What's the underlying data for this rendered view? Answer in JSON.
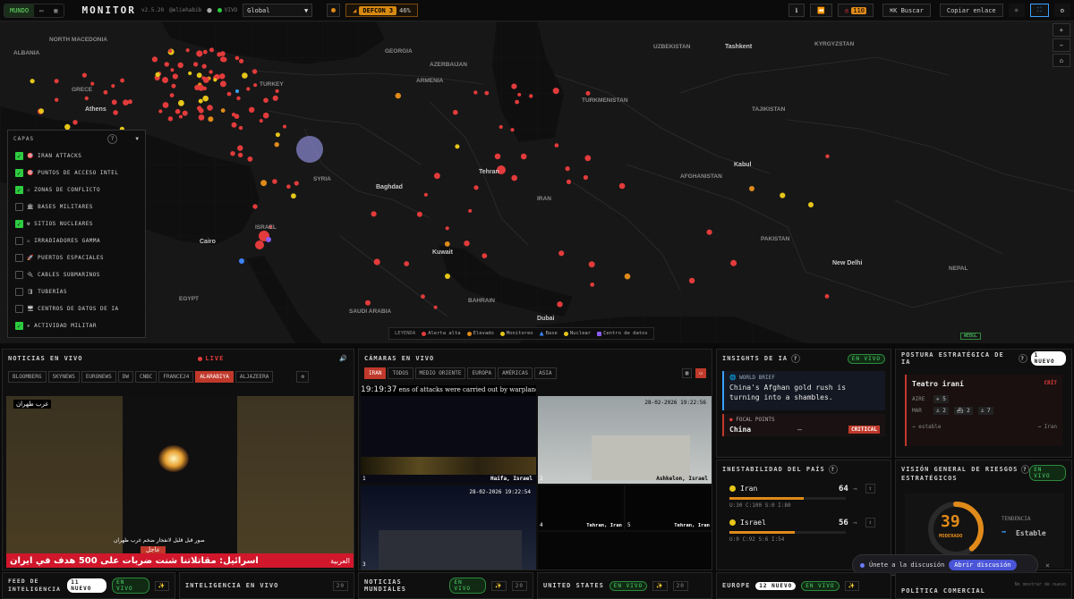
{
  "topbar": {
    "modes": [
      "MUNDO",
      "▭",
      "▦"
    ],
    "brand": "MONITOR",
    "version": "v2.5.20",
    "author": "@eliehabib",
    "live": "VIVO",
    "region": "Global",
    "defcon": "DEFCON 3",
    "defcon_pct": "46%",
    "alerts_count": "110",
    "search_label": "⌘K Buscar",
    "copy_label": "Copiar enlace"
  },
  "map": {
    "labels": [
      {
        "t": "NORTH MACEDONIA"
      },
      {
        "t": "ALBANIA"
      },
      {
        "t": "GRECE"
      },
      {
        "t": "Athens"
      },
      {
        "t": "TURKEY"
      },
      {
        "t": "AZERBAIJAN"
      },
      {
        "t": "GEORGIA"
      },
      {
        "t": "ARMENIA"
      },
      {
        "t": "UZBEKISTAN"
      },
      {
        "t": "TURKMENISTAN"
      },
      {
        "t": "Tashkent"
      },
      {
        "t": "KYRGYZSTAN"
      },
      {
        "t": "TAJIKISTAN"
      },
      {
        "t": "SYRIA"
      },
      {
        "t": "Tehran"
      },
      {
        "t": "Baghdad"
      },
      {
        "t": "IRAN"
      },
      {
        "t": "AFGHANISTAN"
      },
      {
        "t": "Kabul"
      },
      {
        "t": "PAKISTAN"
      },
      {
        "t": "ISRAEL"
      },
      {
        "t": "Cairo"
      },
      {
        "t": "EGYPT"
      },
      {
        "t": "SAUDI ARABIA"
      },
      {
        "t": "New Delhi"
      },
      {
        "t": "NEPAL"
      },
      {
        "t": "Dubai"
      },
      {
        "t": "Kuwait"
      },
      {
        "t": "BAHRAIN"
      }
    ],
    "legend_title": "LEYENDA",
    "legend": [
      {
        "label": "Alerta alta",
        "color": "#e33b3b"
      },
      {
        "label": "Elevado",
        "color": "#e08a1a"
      },
      {
        "label": "Monitoreo",
        "color": "#e6c619"
      },
      {
        "label": "Base",
        "color": "#3b82f6"
      },
      {
        "label": "Nuclear",
        "color": "#e6c619"
      },
      {
        "label": "Centro de datos",
        "color": "#8b5cf6"
      }
    ],
    "webgl": "WEBGL"
  },
  "layers": {
    "title": "CAPAS",
    "items": [
      {
        "label": "IRAN ATTACKS",
        "on": true,
        "icon": "🎯"
      },
      {
        "label": "PUNTOS DE ACCESO INTEL",
        "on": true,
        "icon": "🎯"
      },
      {
        "label": "ZONAS DE CONFLICTO",
        "on": true,
        "icon": "⚔"
      },
      {
        "label": "BASES MILITARES",
        "on": false,
        "icon": "🏛"
      },
      {
        "label": "SITIOS NUCLEARES",
        "on": true,
        "icon": "☢"
      },
      {
        "label": "IRRADIADORES GAMMA",
        "on": false,
        "icon": "⚠"
      },
      {
        "label": "PUERTOS ESPACIALES",
        "on": false,
        "icon": "🚀"
      },
      {
        "label": "CABLES SUBMARINOS",
        "on": false,
        "icon": "🔌"
      },
      {
        "label": "TUBERÍAS",
        "on": false,
        "icon": "🛢"
      },
      {
        "label": "CENTROS DE DATOS DE IA",
        "on": false,
        "icon": "🖥"
      },
      {
        "label": "ACTIVIDAD MILITAR",
        "on": true,
        "icon": "✈"
      }
    ]
  },
  "news": {
    "title": "NOTICIAS EN VIVO",
    "live": "LIVE",
    "channels": [
      "BLOOMBERG",
      "SKYNEWS",
      "EURONEWS",
      "DW",
      "CNBC",
      "FRANCE24",
      "ALARABIYA",
      "ALJAZEERA"
    ],
    "active_channel": "ALARABIYA",
    "tag": "غرب طهران",
    "caption_small": "صور قبل قليل لانفجار ضخم غرب طهران",
    "urgent": "عاجل",
    "headline": "اسرائيل: مقاتلاتنا شنت ضربات على 500 هدف في ايران",
    "logo": "العربية"
  },
  "cams": {
    "title": "CÁMARAS EN VIVO",
    "tabs": [
      "IRAN",
      "TODOS",
      "MEDIO ORIENTE",
      "EUROPA",
      "AMÉRICAS",
      "ASIA"
    ],
    "active": "IRAN",
    "clock": "19:19:37",
    "ticker": "ens of attacks were carried out by warplanes launched from bases and aircraft carrie",
    "feeds": [
      {
        "n": "1",
        "loc": "Haifa, Israel"
      },
      {
        "n": "2",
        "loc": "Ashkelon, Israel",
        "ts": "28-02-2026 19:22:56"
      },
      {
        "n": "3",
        "loc": "",
        "ts": "28-02-2026 19:22:54"
      },
      {
        "n": "4",
        "loc": "Tehran, Iran"
      },
      {
        "n": "5",
        "loc": "Tehran, Iran"
      }
    ]
  },
  "insights": {
    "title": "INSIGHTS DE IA",
    "live": "EN VIVO",
    "brief_label": "WORLD BRIEF",
    "brief_text": "China's Afghan gold rush is turning into a shambles.",
    "focal_label": "FOCAL POINTS",
    "focal_name": "China",
    "focal_dash": "—",
    "focal_level": "CRITICAL"
  },
  "instability": {
    "title": "INESTABILIDAD DEL PAÍS",
    "rows": [
      {
        "name": "Iran",
        "score": "64",
        "trend": "→",
        "metrics": "U:30  C:100  S:0  I:80",
        "fill": 0.64
      },
      {
        "name": "Israel",
        "score": "56",
        "trend": "→",
        "metrics": "U:0  C:92  S:6  I:54",
        "fill": 0.56
      }
    ]
  },
  "posture": {
    "title": "POSTURA ESTRATÉGICA DE IA",
    "badge": "1 NUEVO",
    "theater": "Teatro iraní",
    "level": "CRÍT",
    "air_label": "AIRE",
    "air": "✈ 5",
    "sea_label": "MAR",
    "sea": [
      "⚓ 2",
      "⛴ 2",
      "⚓ 7"
    ],
    "stable": "→ estable",
    "target": "→ Iran"
  },
  "risk": {
    "title": "VISIÓN GENERAL DE RIESGOS ESTRATÉGICOS",
    "live": "EN VIVO",
    "score": "39",
    "level": "MODERADO",
    "trend_label": "TENDENCIA",
    "trend_value": "Estable",
    "gauge": 0.39
  },
  "discussion": {
    "text": "Únete a la discusión",
    "button": "Abrir discusión"
  },
  "bottom": [
    {
      "title": "FEED DE INTELIGENCIA",
      "badge": "11 NUEVO",
      "live": "EN VIVO"
    },
    {
      "title": "INTELIGENCIA EN VIVO",
      "count": "20"
    },
    {
      "title": "NOTICIAS MUNDIALES",
      "live": "EN VIVO",
      "count": "20"
    },
    {
      "title": "UNITED STATES",
      "live": "EN VIVO",
      "count": "20"
    },
    {
      "title": "EUROPE",
      "badge": "12 NUEVO",
      "live": "EN VIVO",
      "count": "20"
    },
    {
      "title": "POLÍTICA COMERCIAL",
      "note": "No mostrar de nuevo"
    }
  ]
}
